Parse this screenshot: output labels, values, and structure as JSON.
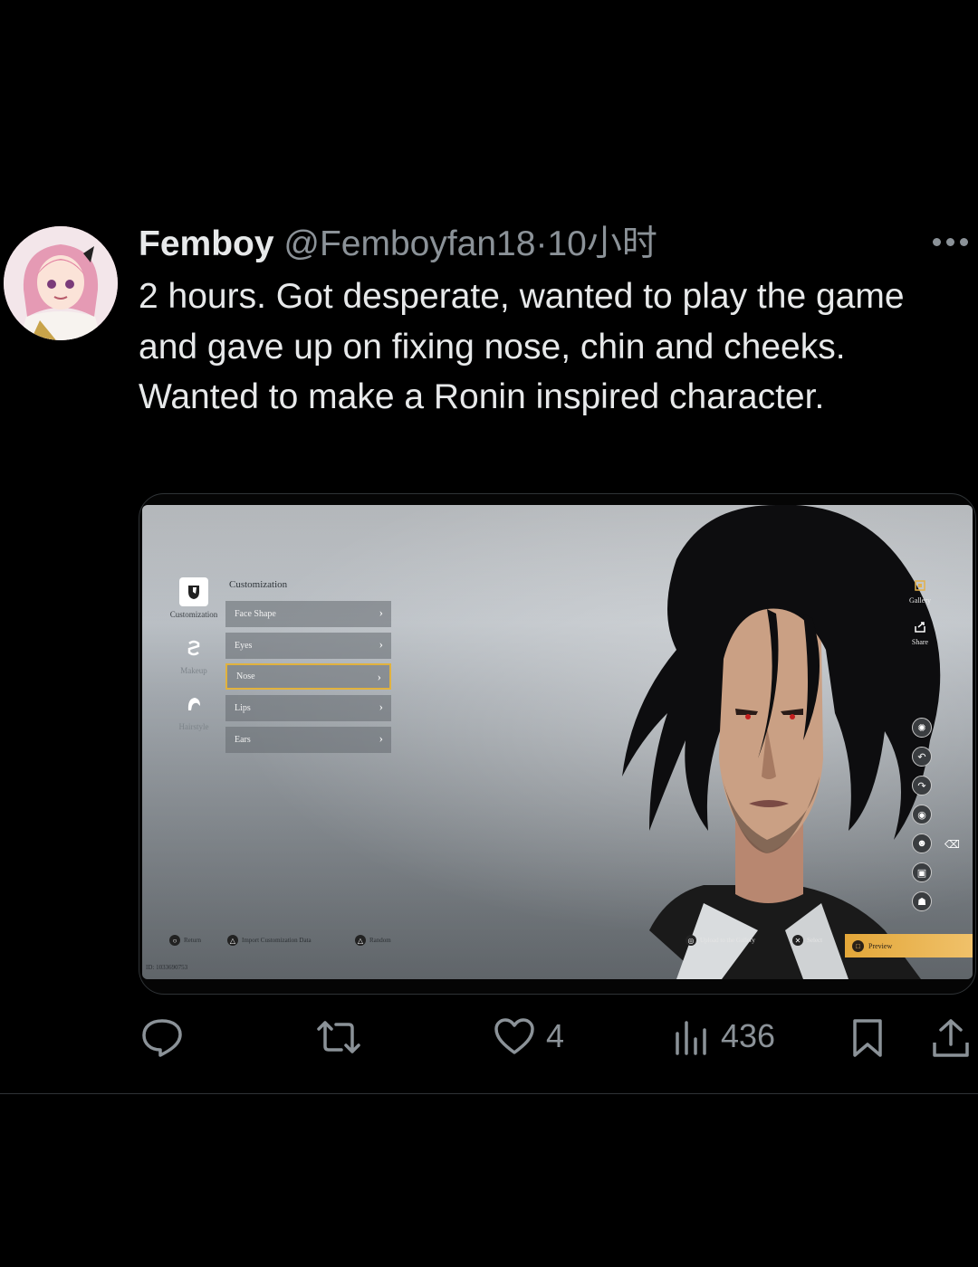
{
  "tweet": {
    "display_name": "Femboy",
    "handle": "@Femboyfan18",
    "separator": "·",
    "time": "10小时",
    "text": "2 hours. Got desperate, wanted to play the game and gave up on fixing nose, chin and cheeks. Wanted to make a Ronin inspired character."
  },
  "game_ui": {
    "menu_title": "Customization",
    "categories": [
      {
        "label": "Customization",
        "icon": "customization-icon",
        "active": true
      },
      {
        "label": "Makeup",
        "icon": "makeup-icon",
        "active": false
      },
      {
        "label": "Hairstyle",
        "icon": "hairstyle-icon",
        "active": false
      }
    ],
    "menu_items": [
      {
        "label": "Face Shape",
        "selected": false
      },
      {
        "label": "Eyes",
        "selected": false
      },
      {
        "label": "Nose",
        "selected": true
      },
      {
        "label": "Lips",
        "selected": false
      },
      {
        "label": "Ears",
        "selected": false
      }
    ],
    "right_panel": {
      "gallery_label": "Gallery",
      "share_label": "Share"
    },
    "bottom_hints": {
      "return": "Return",
      "import": "Import Customization Data",
      "random": "Random",
      "upload": "Upload to the Gallery",
      "select": "Select",
      "preview": "Preview"
    },
    "player_id": "ID: 1033690753",
    "accent_color": "#e1b23e"
  },
  "actions": {
    "reply_icon": "reply-icon",
    "retweet_icon": "retweet-icon",
    "likes": "4",
    "views": "436",
    "bookmark_icon": "bookmark-icon",
    "share_icon": "share-icon"
  }
}
